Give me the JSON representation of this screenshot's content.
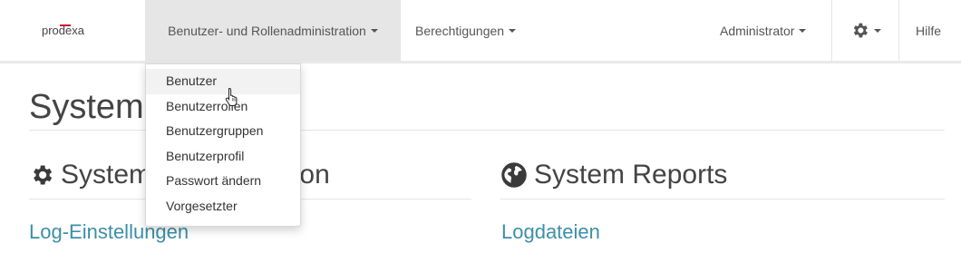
{
  "navbar": {
    "brand": {
      "pre": "pro",
      "accent": "de",
      "post": "xa"
    },
    "menu_users": "Benutzer- und Rollenadministration",
    "menu_permissions": "Berechtigungen",
    "menu_user": "Administrator",
    "menu_settings_icon": "gear-icon",
    "menu_help": "Hilfe"
  },
  "dropdown": {
    "items": [
      "Benutzer",
      "Benutzerrollen",
      "Benutzergruppen",
      "Benutzerprofil",
      "Passwort ändern",
      "Vorgesetzter"
    ],
    "hovered_item": "Benutzer"
  },
  "page": {
    "title": "System",
    "sections": [
      {
        "icon": "gear-icon",
        "title": "System Administration",
        "link": "Log-Einstellungen"
      },
      {
        "icon": "globe-icon",
        "title": "System Reports",
        "link": "Logdateien"
      }
    ]
  }
}
